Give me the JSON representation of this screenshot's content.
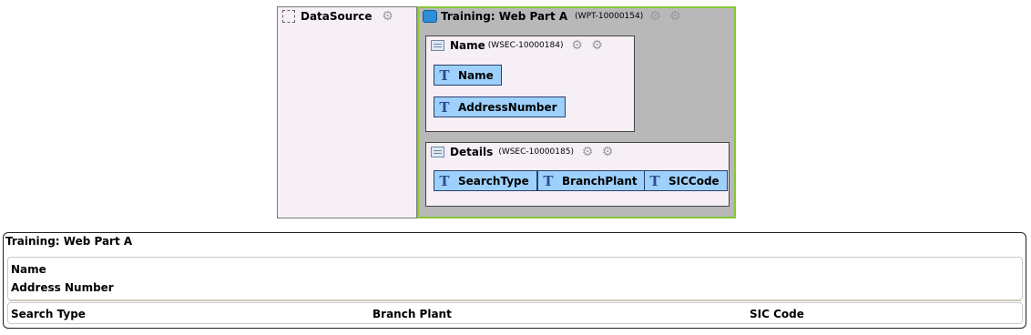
{
  "designer": {
    "datasource": {
      "label": "DataSource",
      "icon": "dashed-box-icon"
    },
    "webpart": {
      "title": "Training: Web Part A",
      "id": "(WPT-10000154)",
      "sections": [
        {
          "title": "Name",
          "id": "(WSEC-10000184)",
          "fields": [
            "Name",
            "AddressNumber"
          ]
        },
        {
          "title": "Details",
          "id": "(WSEC-10000185)",
          "fields": [
            "SearchType",
            "BranchPlant",
            "SICCode"
          ]
        }
      ]
    }
  },
  "preview": {
    "title": "Training: Web Part A",
    "name_section": {
      "rows": [
        "Name",
        "Address Number"
      ]
    },
    "details_section": {
      "cols": [
        "Search Type",
        "Branch Plant",
        "SIC Code"
      ]
    }
  },
  "colors": {
    "chip_bg": "#9dd0fb",
    "webpart_border": "#86c737",
    "webpart_bg": "#b8b8b8",
    "section_bg": "#f6f0f6"
  }
}
